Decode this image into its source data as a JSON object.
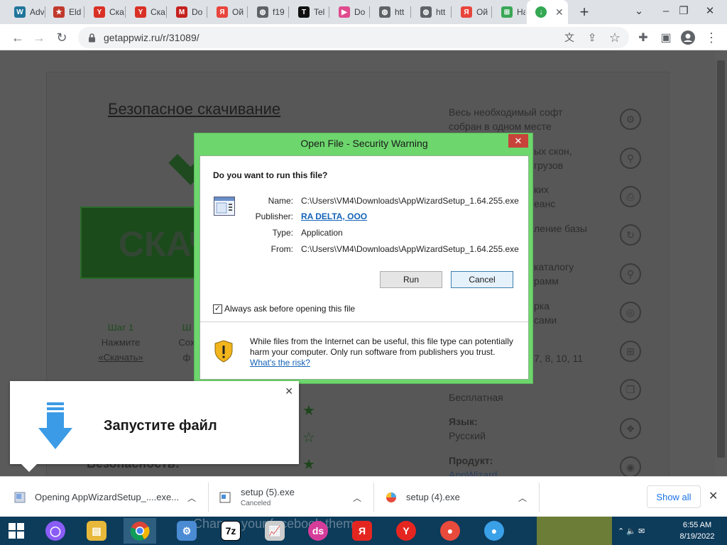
{
  "browser": {
    "tabs": [
      {
        "label": "Adv",
        "icon": "wordpress-icon",
        "color": "#21759b",
        "glyph": "W"
      },
      {
        "label": "Eld",
        "icon": "emblem-icon",
        "color": "#c0392b",
        "glyph": "★"
      },
      {
        "label": "Ска",
        "icon": "yandex-icon",
        "color": "#d93025",
        "glyph": "Y"
      },
      {
        "label": "Ска",
        "icon": "yandex-icon",
        "color": "#d93025",
        "glyph": "Y"
      },
      {
        "label": "Do",
        "icon": "mail-icon",
        "color": "#c5221f",
        "glyph": "M"
      },
      {
        "label": "Ой",
        "icon": "yandex-browser-icon",
        "color": "#e8453c",
        "glyph": "Я"
      },
      {
        "label": "f19",
        "icon": "globe-icon",
        "color": "#5f6368",
        "glyph": "◍"
      },
      {
        "label": "Tel",
        "icon": "tiktok-icon",
        "color": "#111111",
        "glyph": "T"
      },
      {
        "label": "Do",
        "icon": "play-icon",
        "color": "#e04b8e",
        "glyph": "▶"
      },
      {
        "label": "htt",
        "icon": "globe-icon",
        "color": "#5f6368",
        "glyph": "◍"
      },
      {
        "label": "htt",
        "icon": "globe-icon",
        "color": "#5f6368",
        "glyph": "◍"
      },
      {
        "label": "Ой",
        "icon": "yandex-browser-icon",
        "color": "#e8453c",
        "glyph": "Я"
      },
      {
        "label": "На",
        "icon": "windows-icon",
        "color": "#3aa757",
        "glyph": "⊞"
      },
      {
        "label": "",
        "icon": "download-icon",
        "color": "#34a853",
        "glyph": "↓",
        "active": true
      }
    ],
    "url": "getappwiz.ru/r/31089/"
  },
  "page": {
    "title": "Безопасное скачивание",
    "big_button": "СКАЧ",
    "step1_title": "Шаг 1",
    "step1_line1": "Нажмите",
    "step1_link": "«Скачать»",
    "step2_title": "Ш",
    "step2_line1": "Сох",
    "step2_line2": "ф",
    "features": [
      "Весь необходимый софт",
      "собран в одном месте",
      "ых скон,",
      "грузов",
      "ких",
      "еанс",
      "ление базы",
      "каталогу",
      "рамм",
      "рка",
      "сами",
      "7, 8, 10, 11",
      "Бесплатная",
      "Язык:",
      "Русский",
      "Продукт:",
      "AppWizard"
    ],
    "safety_label": "Безопасность:"
  },
  "dialog": {
    "title": "Open File - Security Warning",
    "question": "Do you want to run this file?",
    "name_label": "Name:",
    "name_value": "C:\\Users\\VM4\\Downloads\\AppWizardSetup_1.64.255.exe",
    "publisher_label": "Publisher:",
    "publisher_value": "RA DELTA, OOO",
    "type_label": "Type:",
    "type_value": "Application",
    "from_label": "From:",
    "from_value": "C:\\Users\\VM4\\Downloads\\AppWizardSetup_1.64.255.exe",
    "run_button": "Run",
    "cancel_button": "Cancel",
    "always_ask_label": "Always ask before opening this file",
    "always_ask_checked": true,
    "warning_text": "While files from the Internet can be useful, this file type can potentially harm your computer. Only run software from publishers you trust.",
    "risk_link": "What's the risk?"
  },
  "toast": {
    "text": "Запустите файл"
  },
  "downloads": {
    "items": [
      {
        "name": "Opening AppWizardSetup_....exe...",
        "status": ""
      },
      {
        "name": "setup (5).exe",
        "status": "Canceled"
      },
      {
        "name": "setup (4).exe",
        "status": ""
      }
    ],
    "show_all": "Show all"
  },
  "taskbar": {
    "time": "6:55 AM",
    "date": "8/19/2022",
    "ghost_text": "Change your facebook theme"
  }
}
